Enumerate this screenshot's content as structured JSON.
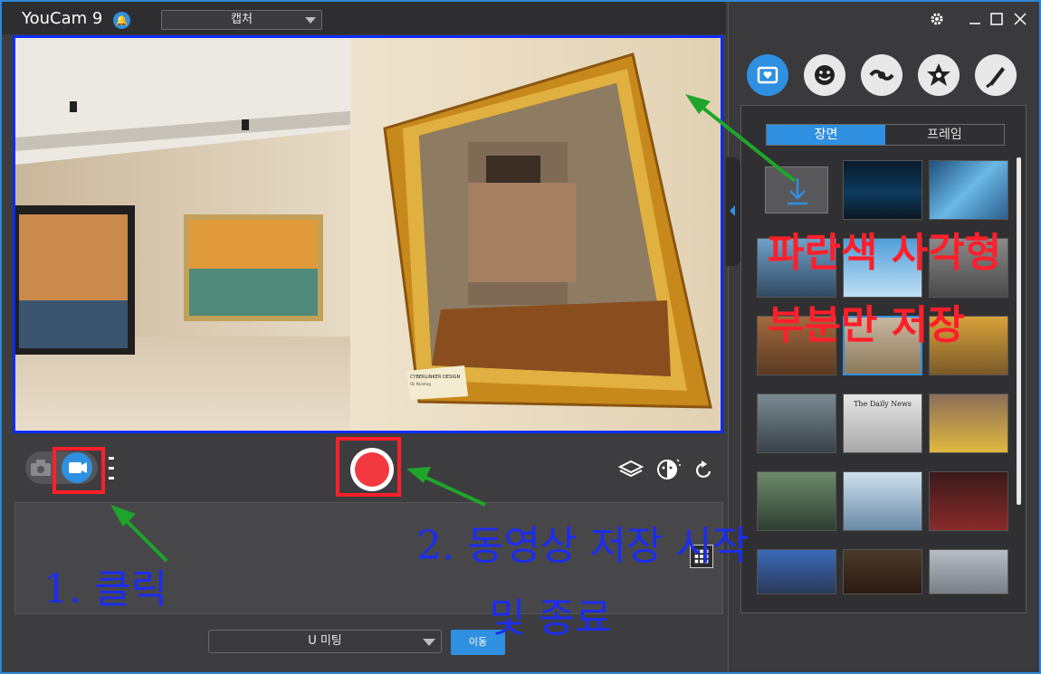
{
  "app": {
    "title": "YouCam 9",
    "notification_icon": "bell-icon"
  },
  "mode_select": {
    "value": "캡처"
  },
  "colors": {
    "accent": "#2f8fe0",
    "record": "#f2393f",
    "annotation_red": "#ff1f2a",
    "annotation_blue": "#1c2cf0",
    "annotation_green": "#1fa52b",
    "preview_border": "#0a2cff"
  },
  "controls": {
    "camera_icon": "camera-icon",
    "video_icon": "video-camera-icon",
    "record_icon": "record-icon",
    "tools": [
      "layers-icon",
      "face-enhance-icon",
      "rotate-icon"
    ]
  },
  "gallery_sign": {
    "line1": "CYBERLINKER DESIGN",
    "line2": "Oil Painting"
  },
  "bottom_bar": {
    "meeting_select": "U 미팅",
    "move_button": "이동"
  },
  "right_panel": {
    "categories": [
      "scene-icon",
      "emoji-icon",
      "effects-icon",
      "particle-icon",
      "brush-icon"
    ],
    "tabs": [
      {
        "label": "장면",
        "active": true
      },
      {
        "label": "프레임",
        "active": false
      }
    ],
    "window_controls": [
      "settings-icon",
      "minimize-icon",
      "maximize-icon",
      "close-icon"
    ],
    "newspaper_title": "The Daily News",
    "thumbnails": [
      "download-scene",
      "hologram-stage",
      "digital-frame",
      "city-billboards",
      "hot-air-balloons",
      "street-signs",
      "hand-frame",
      "gallery-frame",
      "autumn-park",
      "train-station",
      "newspaper",
      "times-square",
      "rock-climbing",
      "cloudy-sky",
      "tv-wall",
      "sky-screen",
      "theater-screen",
      "skyscrapers"
    ]
  },
  "annotations": {
    "step1": "1. 클릭",
    "step2_line1": "2. 동영상 저장 시작",
    "step2_line2": "및 종료",
    "note_line1": "파란색 사각형",
    "note_line2": "부분만 저장"
  }
}
